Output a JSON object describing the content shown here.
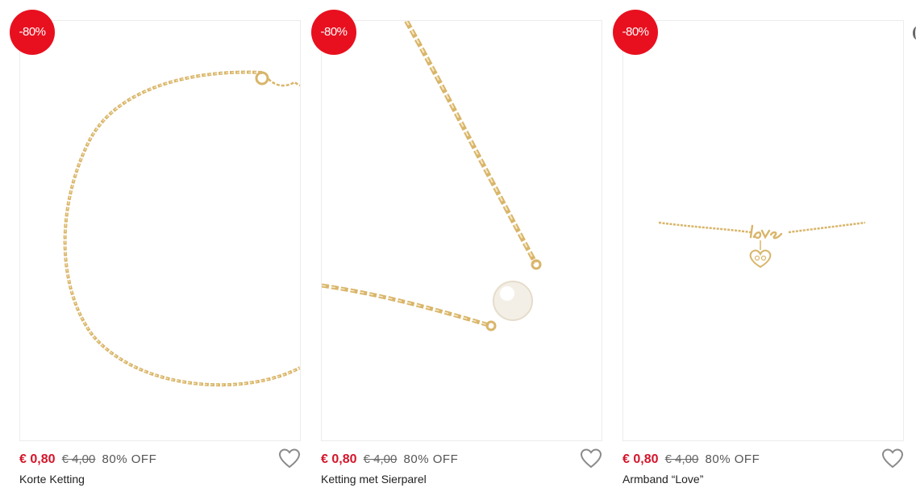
{
  "products": [
    {
      "badge": "-80%",
      "price_now": "€ 0,80",
      "price_old": "€ 4,00",
      "discount_text": "80% OFF",
      "title": "Korte Ketting",
      "image": "gold-chain-choker-photo",
      "wishlist_icon": "heart-icon"
    },
    {
      "badge": "-80%",
      "price_now": "€ 0,80",
      "price_old": "€ 4,00",
      "discount_text": "80% OFF",
      "title": "Ketting met Sierparel",
      "image": "gold-chain-pearl-necklace-photo",
      "wishlist_icon": "heart-icon"
    },
    {
      "badge": "-80%",
      "price_now": "€ 0,80",
      "price_old": "€ 4,00",
      "discount_text": "80% OFF",
      "title": "Armband “Love”",
      "image": "gold-love-bracelet-photo",
      "wishlist_icon": "heart-icon"
    }
  ],
  "colors": {
    "badge_bg": "#e8101f",
    "price_now": "#d3152a",
    "gold": "#d9b56a"
  }
}
